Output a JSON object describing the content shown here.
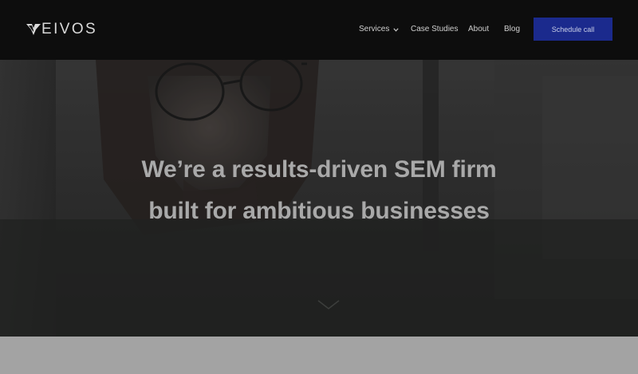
{
  "brand": {
    "name": "EIVOS"
  },
  "nav": {
    "items": [
      {
        "label": "Services",
        "has_dropdown": true
      },
      {
        "label": "Case Studies"
      },
      {
        "label": "About"
      },
      {
        "label": "Blog"
      }
    ],
    "cta_label": "Schedule call"
  },
  "hero": {
    "headline_line1": "We’re a results-driven SEM firm",
    "headline_line2": "built for ambitious businesses",
    "scroll_icon": "chevron-down-icon"
  },
  "colors": {
    "nav_background": "#0d0d0d",
    "cta_background": "#1b2a8d",
    "headline_text": "#a9a9a9",
    "below_fold": "#a3a3a3"
  }
}
